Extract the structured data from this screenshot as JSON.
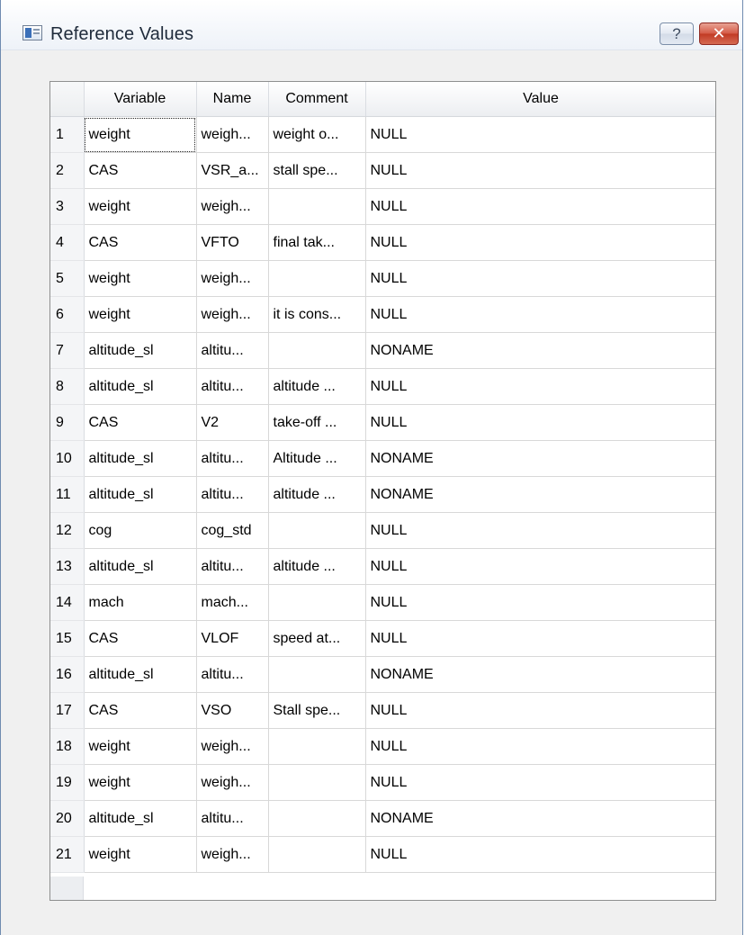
{
  "window": {
    "title": "Reference Values",
    "help_label": "?",
    "close_label": "✕"
  },
  "table": {
    "columns": [
      "Variable",
      "Name",
      "Comment",
      "Value"
    ],
    "rows": [
      {
        "num": "1",
        "variable": "weight",
        "name": "weigh...",
        "comment": "weight o...",
        "value": "NULL"
      },
      {
        "num": "2",
        "variable": "CAS",
        "name": "VSR_a...",
        "comment": "stall spe...",
        "value": "NULL"
      },
      {
        "num": "3",
        "variable": "weight",
        "name": "weigh...",
        "comment": "",
        "value": "NULL"
      },
      {
        "num": "4",
        "variable": "CAS",
        "name": "VFTO",
        "comment": "final tak...",
        "value": "NULL"
      },
      {
        "num": "5",
        "variable": "weight",
        "name": "weigh...",
        "comment": "",
        "value": "NULL"
      },
      {
        "num": "6",
        "variable": "weight",
        "name": "weigh...",
        "comment": "it is cons...",
        "value": "NULL"
      },
      {
        "num": "7",
        "variable": "altitude_sl",
        "name": "altitu...",
        "comment": "",
        "value": "NONAME"
      },
      {
        "num": "8",
        "variable": "altitude_sl",
        "name": "altitu...",
        "comment": "altitude ...",
        "value": "NULL"
      },
      {
        "num": "9",
        "variable": "CAS",
        "name": "V2",
        "comment": "take-off ...",
        "value": "NULL"
      },
      {
        "num": "10",
        "variable": "altitude_sl",
        "name": "altitu...",
        "comment": "Altitude ...",
        "value": "NONAME"
      },
      {
        "num": "11",
        "variable": "altitude_sl",
        "name": "altitu...",
        "comment": "altitude ...",
        "value": "NONAME"
      },
      {
        "num": "12",
        "variable": "cog",
        "name": "cog_std",
        "comment": "",
        "value": "NULL"
      },
      {
        "num": "13",
        "variable": "altitude_sl",
        "name": "altitu...",
        "comment": "altitude ...",
        "value": "NULL"
      },
      {
        "num": "14",
        "variable": "mach",
        "name": "mach...",
        "comment": "",
        "value": "NULL"
      },
      {
        "num": "15",
        "variable": "CAS",
        "name": "VLOF",
        "comment": "speed at...",
        "value": "NULL"
      },
      {
        "num": "16",
        "variable": "altitude_sl",
        "name": "altitu...",
        "comment": "",
        "value": "NONAME"
      },
      {
        "num": "17",
        "variable": "CAS",
        "name": "VSO",
        "comment": "Stall spe...",
        "value": "NULL"
      },
      {
        "num": "18",
        "variable": "weight",
        "name": "weigh...",
        "comment": "",
        "value": "NULL"
      },
      {
        "num": "19",
        "variable": "weight",
        "name": "weigh...",
        "comment": "",
        "value": "NULL"
      },
      {
        "num": "20",
        "variable": "altitude_sl",
        "name": "altitu...",
        "comment": "",
        "value": "NONAME"
      },
      {
        "num": "21",
        "variable": "weight",
        "name": "weigh...",
        "comment": "",
        "value": "NULL"
      }
    ]
  }
}
